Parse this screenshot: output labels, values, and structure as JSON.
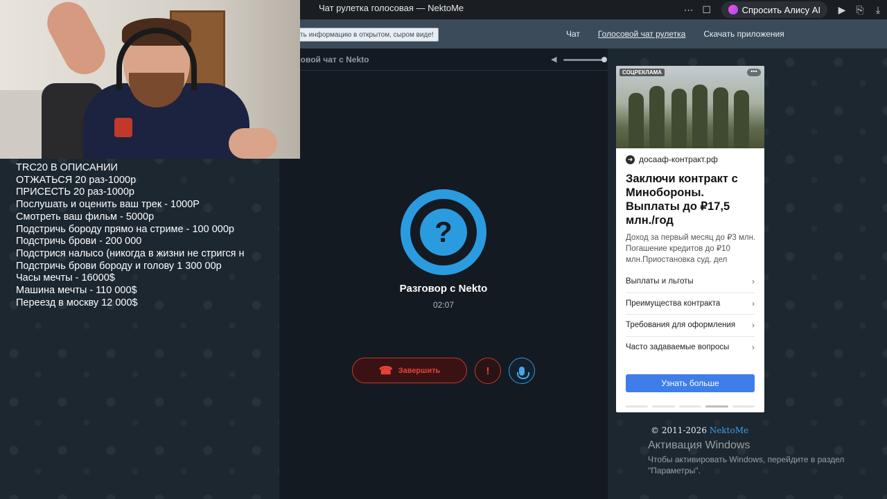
{
  "browser": {
    "tab_title": "Чат рулетка голосовая — NektoMe",
    "ask_alice_label": "Спросить Алису AI",
    "more_icon": "more-horizontal-icon",
    "bookmark_icon": "bookmark-icon"
  },
  "site": {
    "notice_text": "ть информацию в открытом, сыром виде!",
    "nav": [
      {
        "label": "Чат",
        "active": false
      },
      {
        "label": "Голосовой чат рулетка",
        "active": true
      },
      {
        "label": "Скачать приложения",
        "active": false
      }
    ]
  },
  "stream": {
    "lines": [
      "TRC20 В ОПИСАНИИ",
      "ОТЖАТЬСЯ 20 раз-1000р",
      "ПРИСЕСТЬ 20 раз-1000р",
      "Послушать и оценить ваш трек - 1000Р",
      "Смотреть ваш фильм - 5000р",
      "Подстричь бороду прямо на стриме - 100 000р",
      "Подстричь брови - 200 000",
      "Подстрися налысо (никогда в жизни не стригся н",
      "Подстричь брови бороду и голову 1 300 00р",
      "Часы мечты - 16000$",
      "Машина мечты - 110 000$",
      "Переезд в москву 12 000$"
    ]
  },
  "chat": {
    "header_title": "совой чат с Nekto",
    "volume_level": 1.0,
    "avatar_symbol": "?",
    "conversation_title": "Разговор с Nekto",
    "timer": "02:07",
    "end_label": "Завершить",
    "report_symbol": "!"
  },
  "ad": {
    "tag": "СОЦРЕКЛАМА",
    "menu": "•••",
    "domain": "досааф-контракт.рф",
    "headline": "Заключи контракт с Минобороны. Выплаты до ₽17,5 млн./год",
    "description": "Доход за первый месяц до ₽3 млн. Погашение кредитов до ₽10 млн.Приостановка суд. дел",
    "links": [
      "Выплаты и льготы",
      "Преимущества контракта",
      "Требования для оформления",
      "Часто задаваемые вопросы"
    ],
    "cta": "Узнать больше",
    "carousel_active_index": 3,
    "carousel_count": 5
  },
  "footer": {
    "copyright_prefix": "© 2011-2026",
    "copyright_link": "NektoMe"
  },
  "windows_watermark": {
    "title": "Активация Windows",
    "subtitle": "Чтобы активировать Windows, перейдите в раздел \"Параметры\"."
  }
}
